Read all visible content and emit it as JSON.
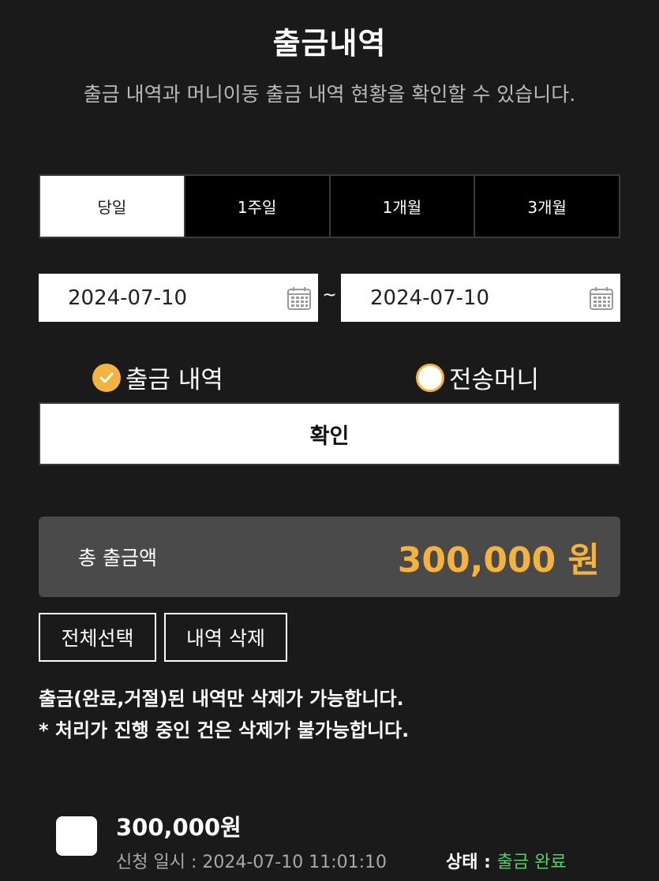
{
  "header": {
    "title": "출금내역",
    "subtitle": "출금 내역과 머니이동 출금 내역 현황을 확인할 수 있습니다."
  },
  "period_tabs": [
    {
      "label": "당일",
      "active": true
    },
    {
      "label": "1주일",
      "active": false
    },
    {
      "label": "1개월",
      "active": false
    },
    {
      "label": "3개월",
      "active": false
    }
  ],
  "date_range": {
    "start": "2024-07-10",
    "separator": "~",
    "end": "2024-07-10",
    "icon": "calendar-icon"
  },
  "filter": {
    "options": [
      {
        "label": "출금 내역",
        "checked": true
      },
      {
        "label": "전송머니",
        "checked": false
      }
    ]
  },
  "confirm_label": "확인",
  "summary": {
    "label": "총 출금액",
    "amount": "300,000 원"
  },
  "actions": {
    "select_all": "전체선택",
    "delete": "내역 삭제"
  },
  "notices": [
    "출금(완료,거절)된 내역만 삭제가 가능합니다.",
    "* 처리가 진행 중인 건은 삭제가 불가능합니다."
  ],
  "records": [
    {
      "amount": "300,000원",
      "date_text": "신청 일시 : 2024-07-10 11:01:10",
      "status_label": "상태 : ",
      "status_value": "출금 완료"
    }
  ],
  "colors": {
    "background": "#1b1a1a",
    "accent": "#f4b340",
    "status_done": "#4fd36a",
    "panel": "#4a4a4a"
  }
}
